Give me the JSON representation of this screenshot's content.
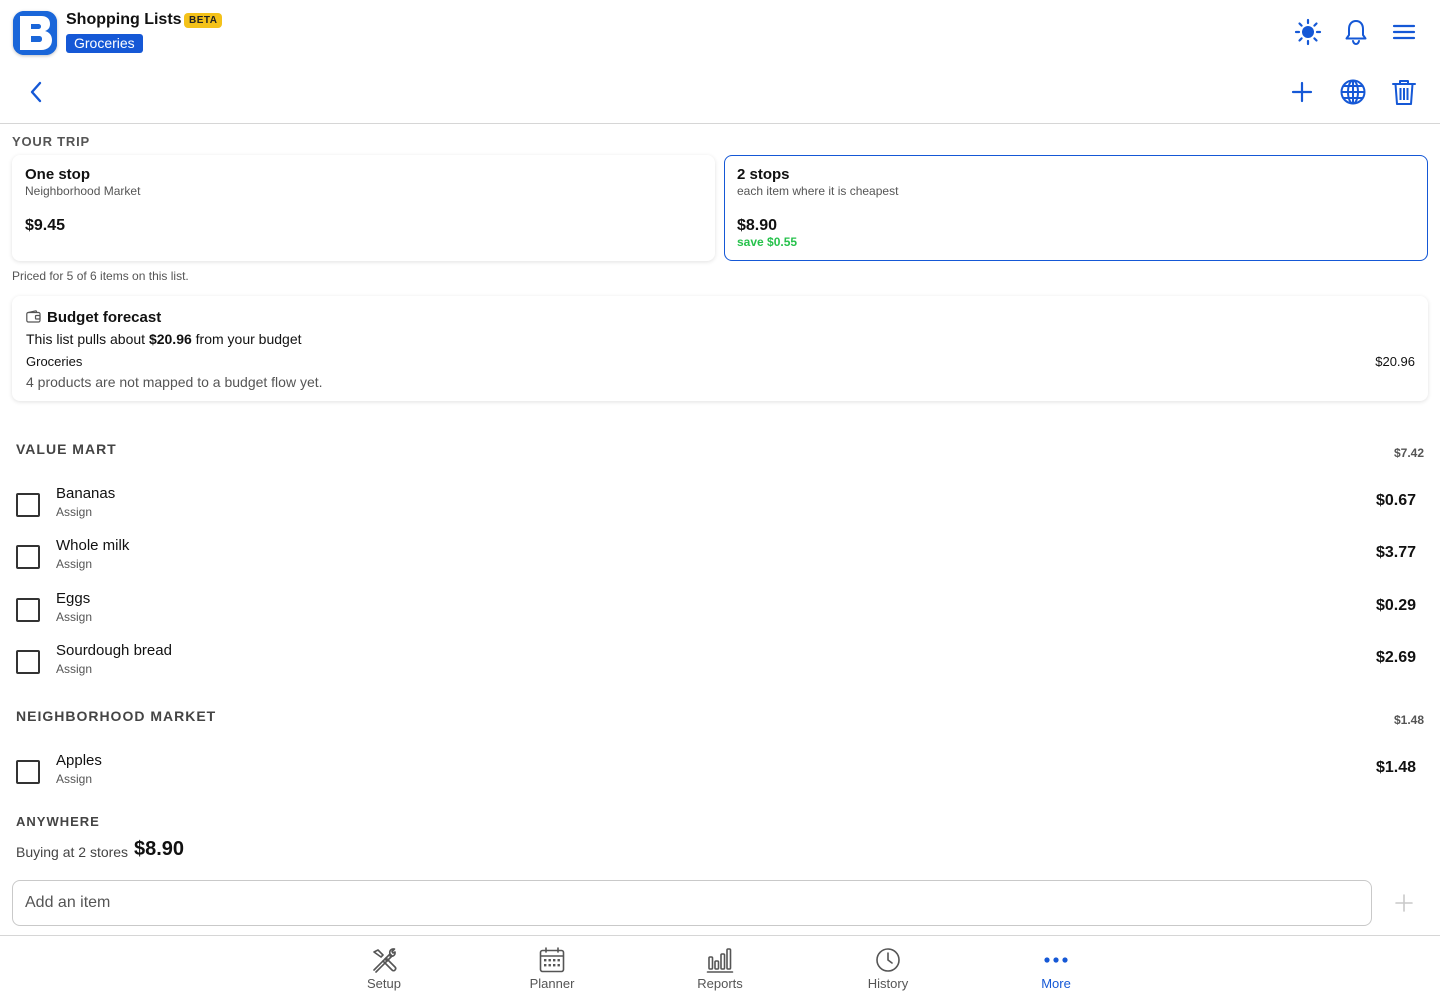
{
  "colors": {
    "accent": "#1558d6",
    "beta": "#f4c21a",
    "save": "#27c24c"
  },
  "header": {
    "title": "Shopping Lists",
    "beta_badge": "BETA",
    "list_name": "Groceries",
    "icons": [
      "sun-icon",
      "bell-icon",
      "menu-icon"
    ]
  },
  "toolbar": {
    "icons": [
      "back-icon",
      "plus-icon",
      "globe-icon",
      "trash-icon"
    ]
  },
  "trip": {
    "label": "YOUR TRIP",
    "one_stop": {
      "title": "One stop",
      "subtitle": "Neighborhood Market",
      "price": "$9.45"
    },
    "two_stops": {
      "title": "2 stops",
      "subtitle": "each item where it is cheapest",
      "price": "$8.90",
      "save": "save $0.55"
    },
    "priced_note": "Priced for 5 of 6 items on this list."
  },
  "budget": {
    "title": "Budget forecast",
    "line_prefix": "This list pulls about ",
    "line_amount": "$20.96",
    "line_suffix": " from your budget",
    "category": "Groceries",
    "category_amount": "$20.96",
    "note": "4 products are not mapped to a budget flow yet."
  },
  "stores": [
    {
      "name": "VALUE MART",
      "total": "$7.42",
      "items": [
        {
          "name": "Bananas",
          "assign": "Assign",
          "price": "$0.67"
        },
        {
          "name": "Whole milk",
          "assign": "Assign",
          "price": "$3.77"
        },
        {
          "name": "Eggs",
          "assign": "Assign",
          "price": "$0.29"
        },
        {
          "name": "Sourdough bread",
          "assign": "Assign",
          "price": "$2.69"
        }
      ]
    },
    {
      "name": "NEIGHBORHOOD MARKET",
      "total": "$1.48",
      "items": [
        {
          "name": "Apples",
          "assign": "Assign",
          "price": "$1.48"
        }
      ]
    }
  ],
  "anywhere": {
    "label": "ANYWHERE",
    "note": "Buying at 2 stores",
    "total": "$8.90"
  },
  "add_item": {
    "placeholder": "Add an item"
  },
  "nav": {
    "active": "More",
    "tabs": [
      {
        "label": "Setup",
        "icon": "tools-icon"
      },
      {
        "label": "Planner",
        "icon": "calendar-icon"
      },
      {
        "label": "Reports",
        "icon": "bar-chart-icon"
      },
      {
        "label": "History",
        "icon": "clock-icon"
      },
      {
        "label": "More",
        "icon": "more-dots-icon"
      }
    ]
  }
}
